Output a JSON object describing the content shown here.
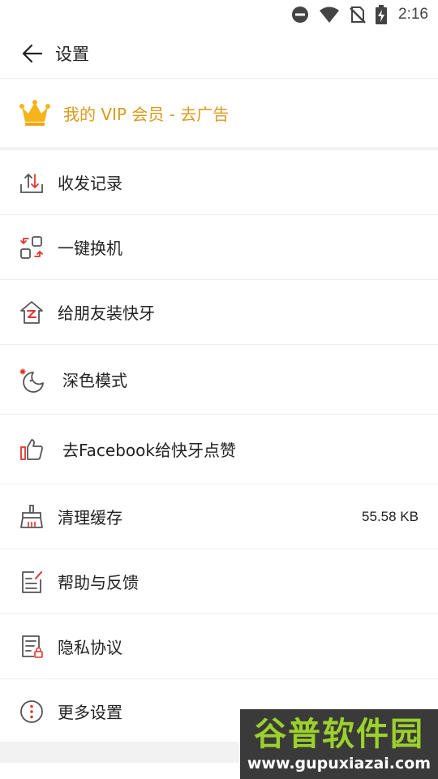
{
  "status_bar": {
    "time": "2:16",
    "icons": [
      "dnd-icon",
      "wifi-icon",
      "no-sim-icon",
      "battery-charging-icon"
    ]
  },
  "header": {
    "title": "设置",
    "back_icon": "arrow-left-icon"
  },
  "vip": {
    "label": "我的 VIP 会员 - 去广告",
    "icon": "crown-icon",
    "color": "#d99a1c"
  },
  "menu": {
    "items": [
      {
        "label": "收发记录",
        "icon": "transfer-history-icon"
      },
      {
        "label": "一键换机",
        "icon": "phone-switch-icon"
      },
      {
        "label": "给朋友装快牙",
        "icon": "install-house-icon"
      },
      {
        "label": "深色模式",
        "icon": "moon-icon"
      },
      {
        "label": "去Facebook给快牙点赞",
        "icon": "thumbs-up-icon"
      },
      {
        "label": "清理缓存",
        "icon": "broom-icon",
        "value": "55.58 KB"
      },
      {
        "label": "帮助与反馈",
        "icon": "feedback-document-icon"
      },
      {
        "label": "隐私协议",
        "icon": "privacy-document-icon"
      },
      {
        "label": "更多设置",
        "icon": "more-vertical-icon"
      }
    ]
  },
  "watermark": {
    "main": "谷普软件园",
    "sub": "www.gupuxiazai.com"
  },
  "colors": {
    "accent": "#e0362c",
    "icon_gray": "#555555",
    "vip_gold": "#d99a1c"
  }
}
